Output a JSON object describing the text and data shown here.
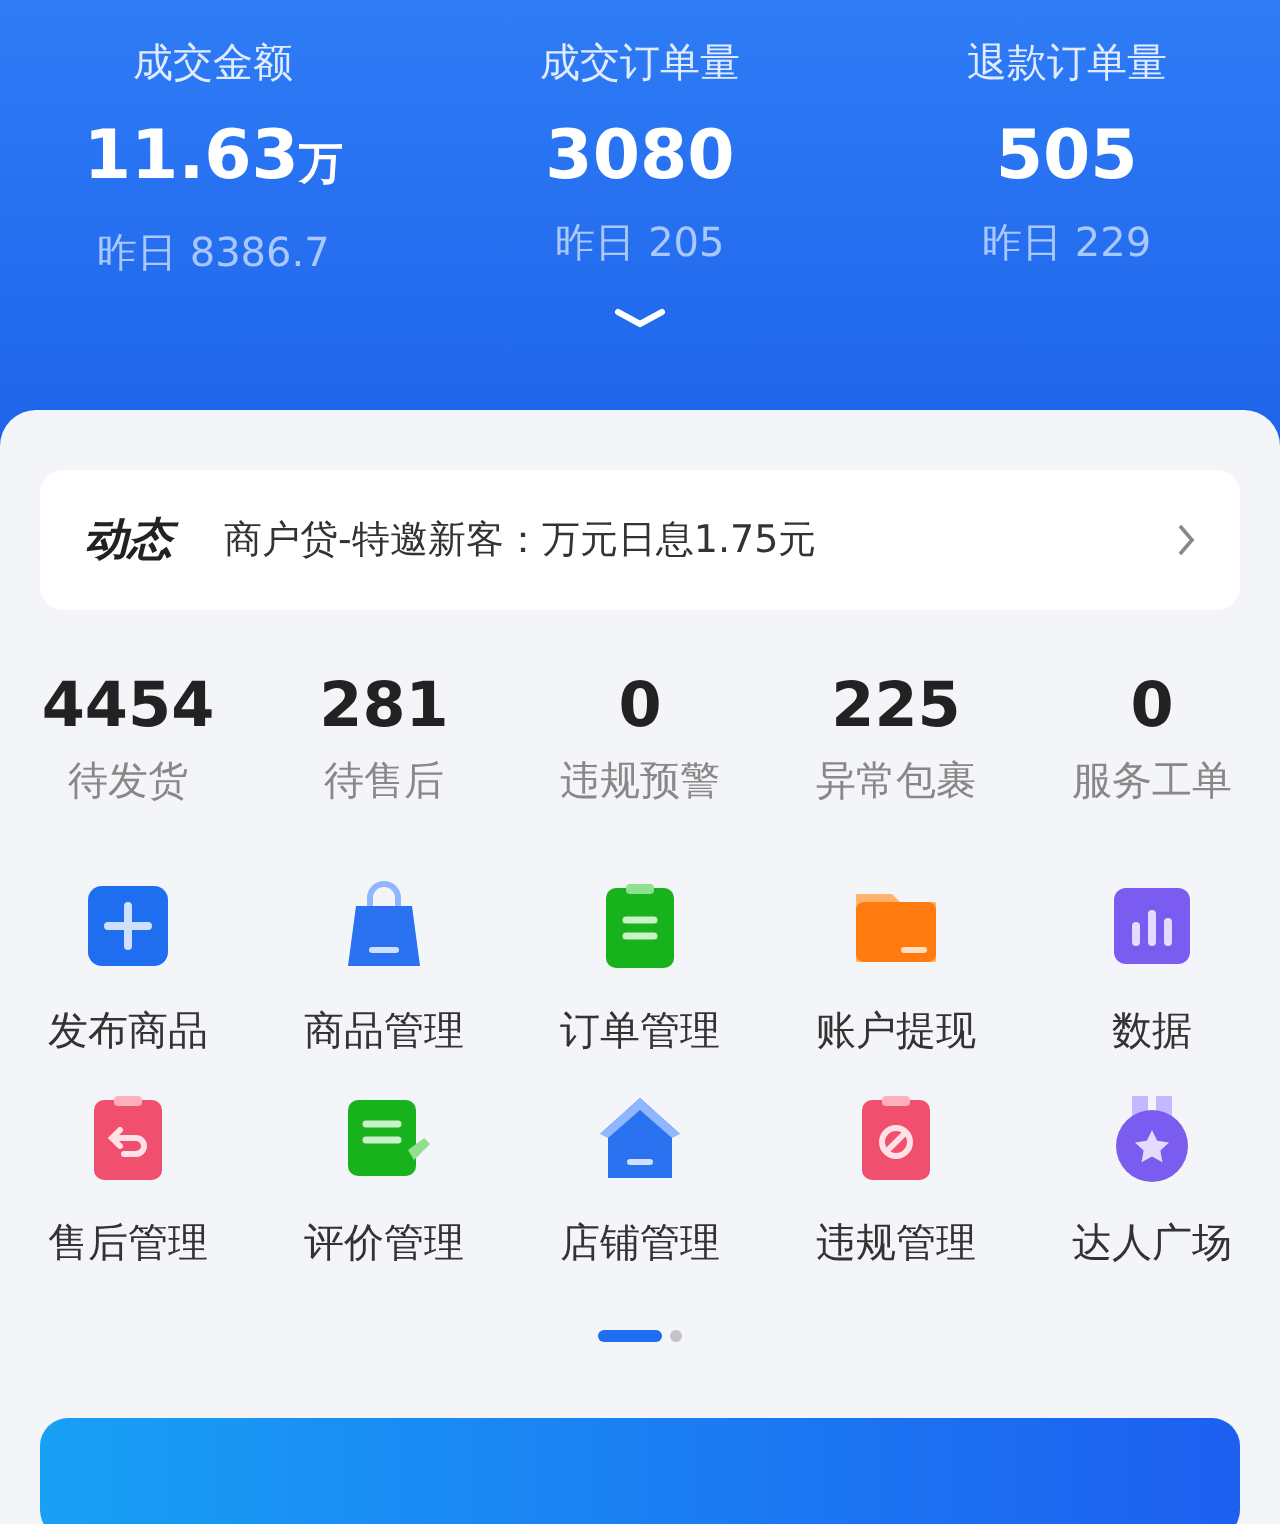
{
  "summary": [
    {
      "label": "成交金额",
      "value": "11.63",
      "unit": "万",
      "yesterday": "昨日 8386.7"
    },
    {
      "label": "成交订单量",
      "value": "3080",
      "yesterday": "昨日 205"
    },
    {
      "label": "退款订单量",
      "value": "505",
      "yesterday": "昨日 229"
    }
  ],
  "news": {
    "tag": "动态",
    "text": "商户贷-特邀新客：万元日息1.75元"
  },
  "stats": [
    {
      "value": "4454",
      "label": "待发货"
    },
    {
      "value": "281",
      "label": "待售后"
    },
    {
      "value": "0",
      "label": "违规预警"
    },
    {
      "value": "225",
      "label": "异常包裹"
    },
    {
      "value": "0",
      "label": "服务工单"
    }
  ],
  "tools": [
    {
      "label": "发布商品",
      "kind": "plus",
      "color": "#1f6ef0"
    },
    {
      "label": "商品管理",
      "kind": "bag",
      "color": "#2a72f0"
    },
    {
      "label": "订单管理",
      "kind": "clipboard",
      "color": "#17b21c"
    },
    {
      "label": "账户提现",
      "kind": "folder",
      "color": "#ff7a0f"
    },
    {
      "label": "数据",
      "kind": "chart",
      "color": "#7a5cf0"
    },
    {
      "label": "售后管理",
      "kind": "return",
      "color": "#f0506e"
    },
    {
      "label": "评价管理",
      "kind": "note",
      "color": "#17b21c"
    },
    {
      "label": "店铺管理",
      "kind": "house",
      "color": "#2a72f0"
    },
    {
      "label": "违规管理",
      "kind": "forbid",
      "color": "#f0506e"
    },
    {
      "label": "达人广场",
      "kind": "medal",
      "color": "#7a5cf0"
    }
  ],
  "pages": [
    {
      "selected": true
    },
    {
      "selected": false
    }
  ]
}
